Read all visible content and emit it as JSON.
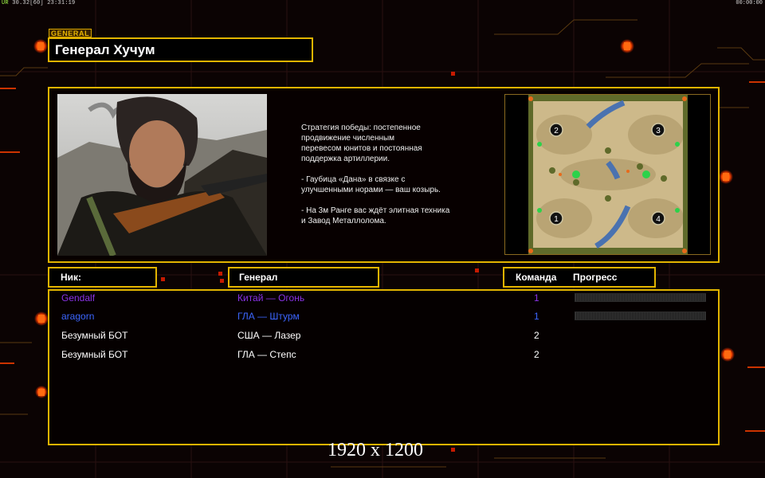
{
  "hud": {
    "indicator": "UR",
    "left_readout": "30.32[60] 23:31:19",
    "right_readout": "00:00:00"
  },
  "general": {
    "tag": "GENERAL",
    "name": "Генерал Хучум"
  },
  "description": [
    "Стратегия победы: постепенное\nпродвижение численным\nперевесом юнитов и постоянная\nподдержка артиллерии.",
    "- Гаубица «Дана» в связке с\nулучшенными норами — ваш козырь.",
    "- На 3м Ранге вас ждёт элитная техника\nи Завод Металлолома."
  ],
  "minimap": {
    "start_positions": [
      "1",
      "2",
      "3",
      "4"
    ]
  },
  "headers": {
    "nick": "Ник:",
    "general": "Генерал",
    "team": "Команда",
    "progress": "Прогресс"
  },
  "players": [
    {
      "nick": "Gendalf",
      "general": "Китай — Огонь",
      "team": "1",
      "color": "#8a33e6",
      "progress": 0
    },
    {
      "nick": "aragorn",
      "general": "ГЛА — Штурм",
      "team": "1",
      "color": "#3c66ff",
      "progress": 0
    },
    {
      "nick": "Безумный БОТ",
      "general": "США — Лазер",
      "team": "2",
      "color": "#ffffff",
      "progress": null
    },
    {
      "nick": "Безумный БОТ",
      "general": "ГЛА — Степс",
      "team": "2",
      "color": "#ffffff",
      "progress": null
    }
  ],
  "resolution_label": "1920 x 1200",
  "colors": {
    "accent_gold": "#e2b400",
    "background": "#0b0303",
    "glow_orange": "#ff5500"
  }
}
